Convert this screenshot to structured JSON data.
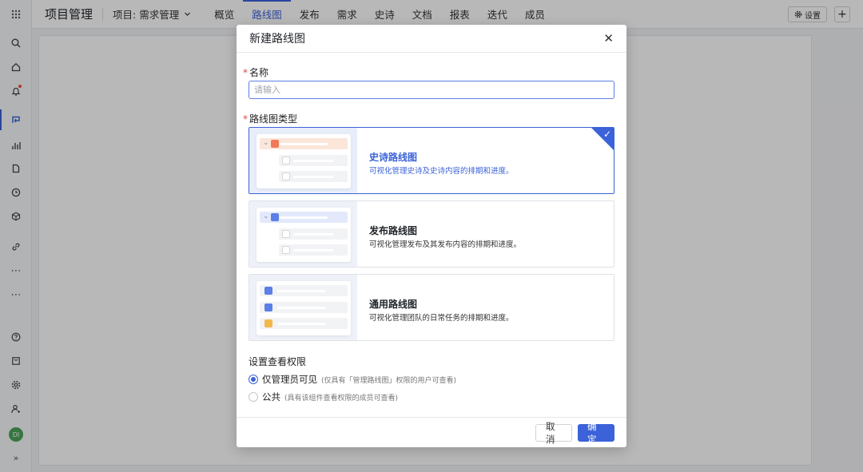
{
  "colors": {
    "accent": "#3b62d8",
    "required": "#e84545"
  },
  "header": {
    "app_title": "项目管理",
    "project_label": "项目: 需求管理",
    "tabs": [
      "概览",
      "路线图",
      "发布",
      "需求",
      "史诗",
      "文档",
      "报表",
      "迭代",
      "成员"
    ],
    "active_tab": "路线图",
    "settings_label": "设置",
    "settings_icon": "gear-icon",
    "add_icon": "plus-icon"
  },
  "rail": {
    "icons": [
      "grid-icon",
      "search-icon",
      "home-icon",
      "bell-icon",
      "roadmap-icon",
      "chart-icon",
      "document-icon",
      "clock-icon",
      "cube-icon",
      "link-icon",
      "more-icon",
      "more-icon",
      "help-icon",
      "inbox-icon",
      "gear-icon",
      "add-member-icon",
      "avatar",
      "expand-icon"
    ],
    "avatar_text": "DI"
  },
  "modal": {
    "title": "新建路线图",
    "name_label": "名称",
    "name_placeholder": "请输入",
    "type_label": "路线图类型",
    "types": [
      {
        "name": "史诗路线图",
        "desc": "可视化管理史诗及史诗内容的排期和进度。",
        "selected": true
      },
      {
        "name": "发布路线图",
        "desc": "可视化管理发布及其发布内容的排期和进度。",
        "selected": false
      },
      {
        "name": "通用路线图",
        "desc": "可视化管理团队的日常任务的排期和进度。",
        "selected": false
      }
    ],
    "permission_title": "设置查看权限",
    "permissions": [
      {
        "label": "仅管理员可见",
        "hint": "(仅具有「管理路线图」权限的用户可查看)",
        "checked": true
      },
      {
        "label": "公共",
        "hint": "(具有该组件查看权限的成员可查看)",
        "checked": false
      }
    ],
    "cancel_label": "取消",
    "ok_label": "确定"
  }
}
